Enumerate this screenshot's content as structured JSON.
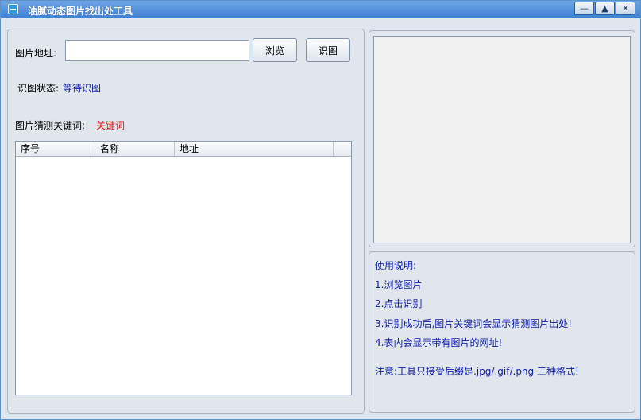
{
  "window": {
    "title": "油腻动态图片找出处工具",
    "buttons": {
      "minimize": "—",
      "maximize": "▲",
      "close": "✕"
    }
  },
  "form": {
    "image_address_label": "图片地址:",
    "image_address_value": "",
    "browse_label": "浏览",
    "recognize_label": "识图",
    "status_label": "识图状态:",
    "status_value": "等待识图",
    "keyword_label": "图片猜测关键词:",
    "keyword_value": "关键词"
  },
  "table": {
    "columns": [
      "序号",
      "名称",
      "地址"
    ],
    "rows": []
  },
  "instructions": {
    "heading": "使用说明:",
    "steps": [
      "1.浏览图片",
      "2.点击识别",
      "3.识别成功后,图片关键词会显示猜测图片出处!",
      "4.表内会显示带有图片的网址!"
    ],
    "note": "注意:工具只接受后缀是.jpg/.gif/.png 三种格式!"
  },
  "colors": {
    "status": "#1020a8",
    "keyword": "#e01010",
    "instructions": "#1020a8"
  }
}
